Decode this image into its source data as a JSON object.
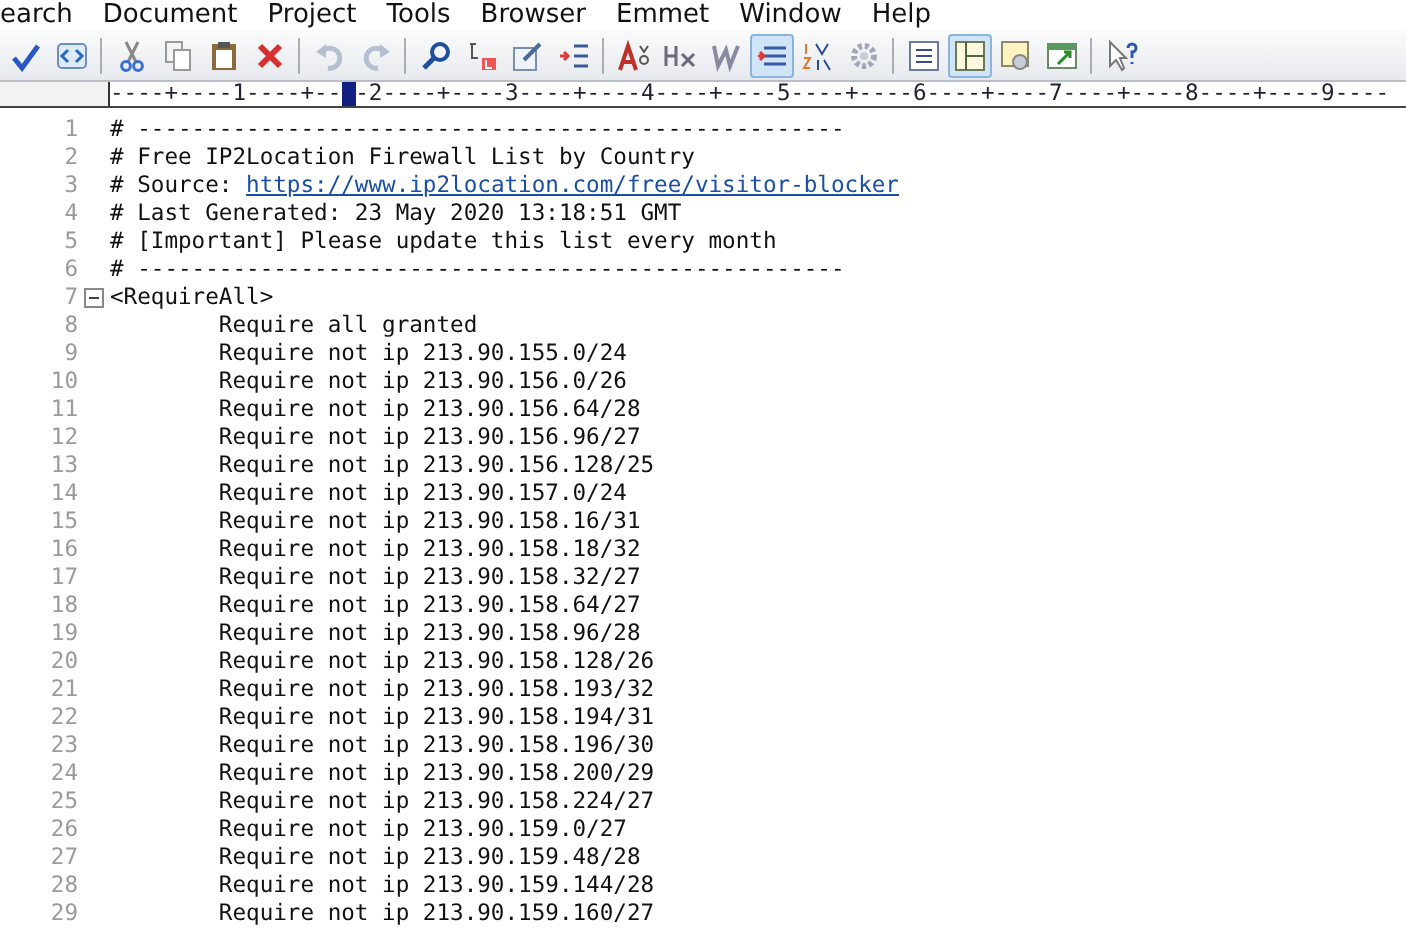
{
  "menu": [
    "earch",
    "Document",
    "Project",
    "Tools",
    "Browser",
    "Emmet",
    "Window",
    "Help"
  ],
  "toolbar": [
    {
      "kind": "spell",
      "pressed": false
    },
    {
      "kind": "tag",
      "pressed": false
    },
    {
      "kind": "sep"
    },
    {
      "kind": "cut",
      "pressed": false
    },
    {
      "kind": "copy",
      "pressed": false
    },
    {
      "kind": "paste",
      "pressed": false
    },
    {
      "kind": "delete",
      "pressed": false
    },
    {
      "kind": "sep"
    },
    {
      "kind": "undo",
      "pressed": false
    },
    {
      "kind": "redo",
      "pressed": false
    },
    {
      "kind": "sep"
    },
    {
      "kind": "search",
      "pressed": false
    },
    {
      "kind": "replace",
      "pressed": false
    },
    {
      "kind": "edit",
      "pressed": false
    },
    {
      "kind": "indent",
      "pressed": false
    },
    {
      "kind": "sep"
    },
    {
      "kind": "font",
      "pressed": false
    },
    {
      "kind": "heading",
      "pressed": false
    },
    {
      "kind": "wordcount",
      "pressed": false
    },
    {
      "kind": "wrap",
      "pressed": true
    },
    {
      "kind": "sort",
      "pressed": false
    },
    {
      "kind": "gear",
      "pressed": false
    },
    {
      "kind": "sep"
    },
    {
      "kind": "list",
      "pressed": false
    },
    {
      "kind": "layout",
      "pressed": true
    },
    {
      "kind": "doc",
      "pressed": false
    },
    {
      "kind": "window",
      "pressed": false
    },
    {
      "kind": "sep"
    },
    {
      "kind": "help",
      "pressed": false
    }
  ],
  "ruler": {
    "before": "----+----1----+--",
    "after": "-2----+----3----+----4----+----5----+----6----+----7----+----8----+----9----"
  },
  "lines": [
    {
      "number": "1",
      "text": "# ----------------------------------------------------"
    },
    {
      "number": "2",
      "text": "# Free IP2Location Firewall List by Country"
    },
    {
      "number": "3",
      "text": "# Source: ",
      "link": "https://www.ip2location.com/free/visitor-blocker"
    },
    {
      "number": "4",
      "text": "# Last Generated: 23 May 2020 13:18:51 GMT"
    },
    {
      "number": "5",
      "text": "# [Important] Please update this list every month"
    },
    {
      "number": "6",
      "text": "# ----------------------------------------------------"
    },
    {
      "number": "7",
      "text": "<RequireAll>",
      "expanded": true
    },
    {
      "number": "8",
      "text": "        Require all granted"
    },
    {
      "number": "9",
      "text": "        Require not ip 213.90.155.0/24"
    },
    {
      "number": "10",
      "text": "        Require not ip 213.90.156.0/26"
    },
    {
      "number": "11",
      "text": "        Require not ip 213.90.156.64/28"
    },
    {
      "number": "12",
      "text": "        Require not ip 213.90.156.96/27"
    },
    {
      "number": "13",
      "text": "        Require not ip 213.90.156.128/25"
    },
    {
      "number": "14",
      "text": "        Require not ip 213.90.157.0/24"
    },
    {
      "number": "15",
      "text": "        Require not ip 213.90.158.16/31"
    },
    {
      "number": "16",
      "text": "        Require not ip 213.90.158.18/32"
    },
    {
      "number": "17",
      "text": "        Require not ip 213.90.158.32/27"
    },
    {
      "number": "18",
      "text": "        Require not ip 213.90.158.64/27"
    },
    {
      "number": "19",
      "text": "        Require not ip 213.90.158.96/28"
    },
    {
      "number": "20",
      "text": "        Require not ip 213.90.158.128/26"
    },
    {
      "number": "21",
      "text": "        Require not ip 213.90.158.193/32"
    },
    {
      "number": "22",
      "text": "        Require not ip 213.90.158.194/31"
    },
    {
      "number": "23",
      "text": "        Require not ip 213.90.158.196/30"
    },
    {
      "number": "24",
      "text": "        Require not ip 213.90.158.200/29"
    },
    {
      "number": "25",
      "text": "        Require not ip 213.90.158.224/27"
    },
    {
      "number": "26",
      "text": "        Require not ip 213.90.159.0/27"
    },
    {
      "number": "27",
      "text": "        Require not ip 213.90.159.48/28"
    },
    {
      "number": "28",
      "text": "        Require not ip 213.90.159.144/28"
    },
    {
      "number": "29",
      "text": "        Require not ip 213.90.159.160/27"
    }
  ]
}
